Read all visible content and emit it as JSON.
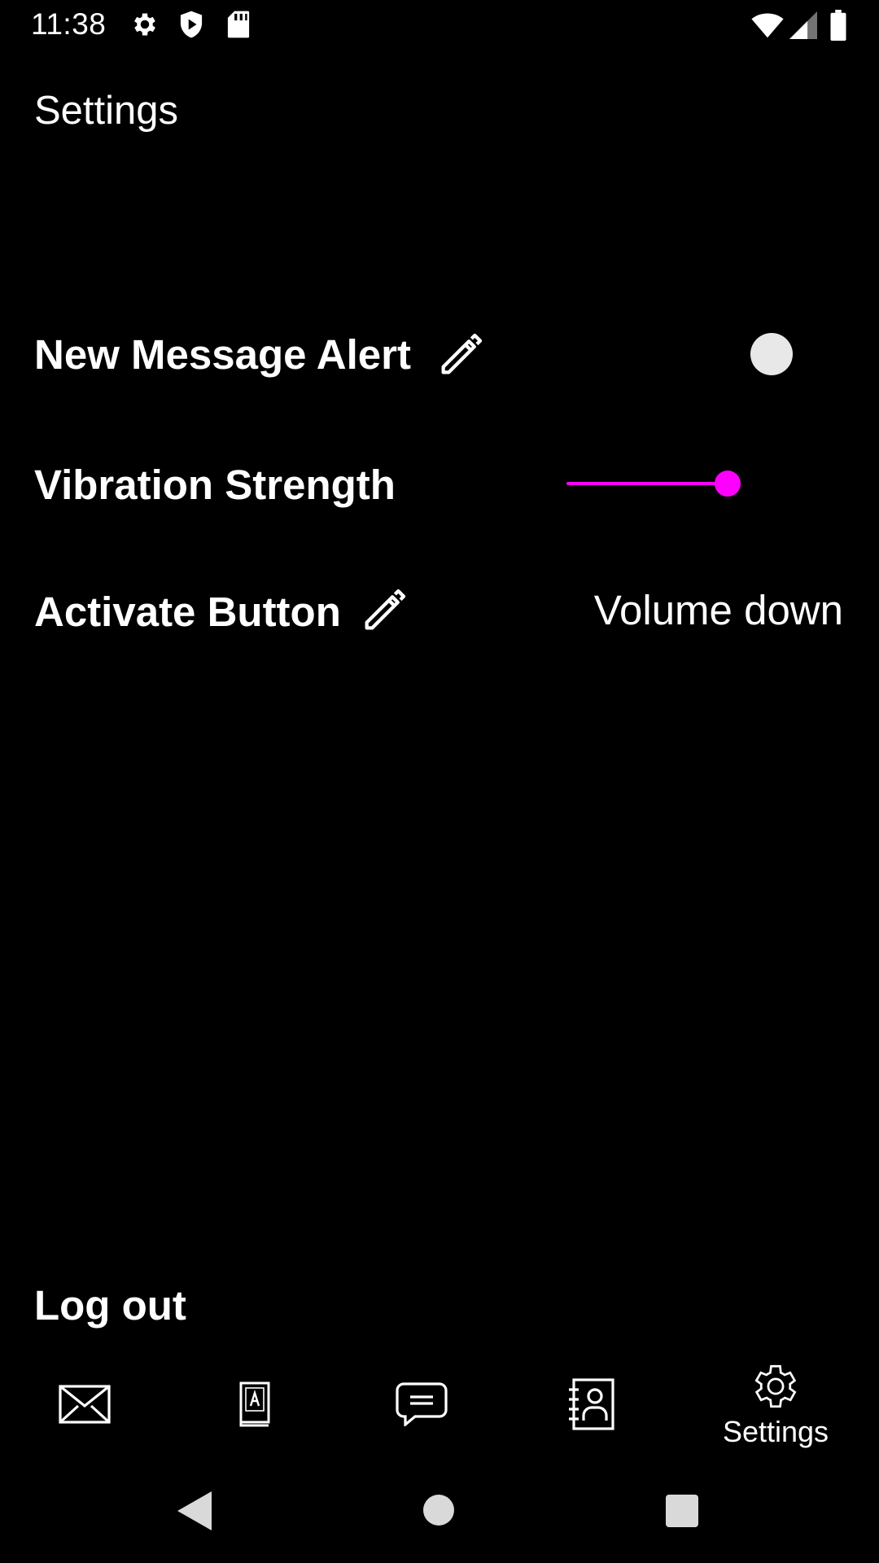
{
  "status_bar": {
    "time": "11:38",
    "left_icons": [
      "gear-icon",
      "shield-icon",
      "sd-card-icon"
    ],
    "right_icons": [
      "wifi-icon",
      "cell-signal-icon",
      "battery-icon"
    ]
  },
  "header": {
    "title": "Settings"
  },
  "settings": {
    "new_message_alert": {
      "label": "New Message Alert",
      "enabled": false
    },
    "vibration_strength": {
      "label": "Vibration Strength",
      "value_fraction": 1.0
    },
    "activate_button": {
      "label": "Activate Button",
      "value": "Volume down"
    }
  },
  "logout_label": "Log out",
  "bottom_nav": {
    "items": [
      {
        "icon": "envelope-icon",
        "label": ""
      },
      {
        "icon": "book-icon",
        "label": ""
      },
      {
        "icon": "chat-bubble-icon",
        "label": ""
      },
      {
        "icon": "contacts-book-icon",
        "label": ""
      },
      {
        "icon": "gear-icon",
        "label": "Settings"
      }
    ],
    "active_index": 4
  },
  "system_nav": [
    "back-icon",
    "home-icon",
    "recents-icon"
  ],
  "colors": {
    "background": "#000000",
    "accent": "#ff00ff",
    "toggle_thumb": "#e8e8e8",
    "text": "#ffffff"
  }
}
